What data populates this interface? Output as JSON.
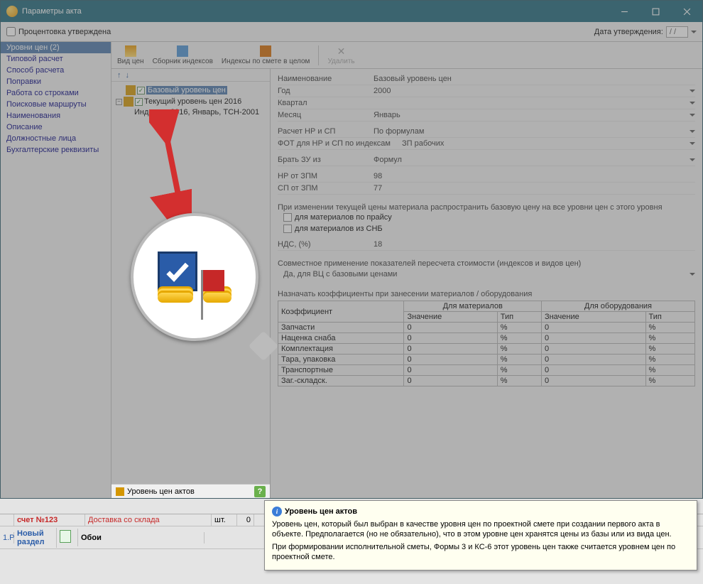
{
  "window": {
    "title": "Параметры акта"
  },
  "topbar": {
    "approved_label": "Процентовка утверждена",
    "date_label": "Дата утверждения:",
    "date_value": "  /  /"
  },
  "nav": {
    "items": [
      "Уровни цен (2)",
      "Типовой расчет",
      "Способ расчета",
      "Поправки",
      "Работа со строками",
      "Поисковые маршруты",
      "Наименования",
      "Описание",
      "Должностные лица",
      "Бухгалтерские реквизиты"
    ]
  },
  "toolbar": {
    "view": "Вид цен",
    "collection": "Сборник индексов",
    "indexes": "Индексы по смете в целом",
    "delete": "Удалить"
  },
  "tree": {
    "base": "Базовый уровень цен",
    "current": "Текущий уровень цен 2016",
    "indexes": "Индексы: 2016, Январь, ТСН-2001"
  },
  "status": {
    "label": "Уровень цен актов"
  },
  "props": {
    "name_l": "Наименование",
    "name_v": "Базовый уровень цен",
    "year_l": "Год",
    "year_v": "2000",
    "quarter_l": "Квартал",
    "month_l": "Месяц",
    "month_v": "Январь",
    "calc_l": "Расчет НР и СП",
    "calc_v": "По формулам",
    "fot_l": "ФОТ для НР и СП по индексам",
    "fot_v": "ЗП рабочих",
    "zu_l": "Брать ЗУ из",
    "zu_v": "Формул",
    "nr_l": "НР от ЗПМ",
    "nr_v": "98",
    "sp_l": "СП от ЗПМ",
    "sp_v": "77",
    "propagate": "При изменении текущей цены материала распространить базовую цену на все уровни цен с этого уровня",
    "chk_price": "для материалов по прайсу",
    "chk_snb": "для материалов из СНБ",
    "nds_l": "НДС, (%)",
    "nds_v": "18",
    "joint_head": "Совместное применение показателей пересчета стоимости (индексов и видов цен)",
    "joint_v": "Да, для ВЦ с базовыми ценами",
    "coef_head": "Назначать коэффициенты при занесении материалов / оборудования",
    "table": {
      "h_coef": "Коэффициент",
      "h_mat": "Для материалов",
      "h_eq": "Для оборудования",
      "h_val": "Значение",
      "h_type": "Тип",
      "rows": [
        {
          "n": "Запчасти",
          "mv": "0",
          "mt": "%",
          "ev": "0",
          "et": "%"
        },
        {
          "n": "Наценка снаба",
          "mv": "0",
          "mt": "%",
          "ev": "0",
          "et": "%"
        },
        {
          "n": "Комплектация",
          "mv": "0",
          "mt": "%",
          "ev": "0",
          "et": "%"
        },
        {
          "n": "Тара, упаковка",
          "mv": "0",
          "mt": "%",
          "ev": "0",
          "et": "%"
        },
        {
          "n": "Транспортные",
          "mv": "0",
          "mt": "%",
          "ev": "0",
          "et": "%"
        },
        {
          "n": "Заг.-складск.",
          "mv": "0",
          "mt": "%",
          "ev": "0",
          "et": "%"
        }
      ]
    }
  },
  "tooltip": {
    "title": "Уровень цен актов",
    "p1": "Уровень цен, который был выбран в качестве уровня цен по проектной смете при создании первого акта в объекте. Предполагается (но не обязательно), что в этом уровне цен хранятся цены из базы или из вида цен.",
    "p2": "При формировании исполнительной сметы, Формы 3 и КС-6 этот уровень цен также считается уровнем цен по проектной смете."
  },
  "bottomgrid": {
    "r1c1": "счет №123",
    "r1c2": "Доставка со склада",
    "r1c3": "шт.",
    "r1c4": "0",
    "r2c1": "Новый раздел",
    "r2c2": "Обои"
  }
}
